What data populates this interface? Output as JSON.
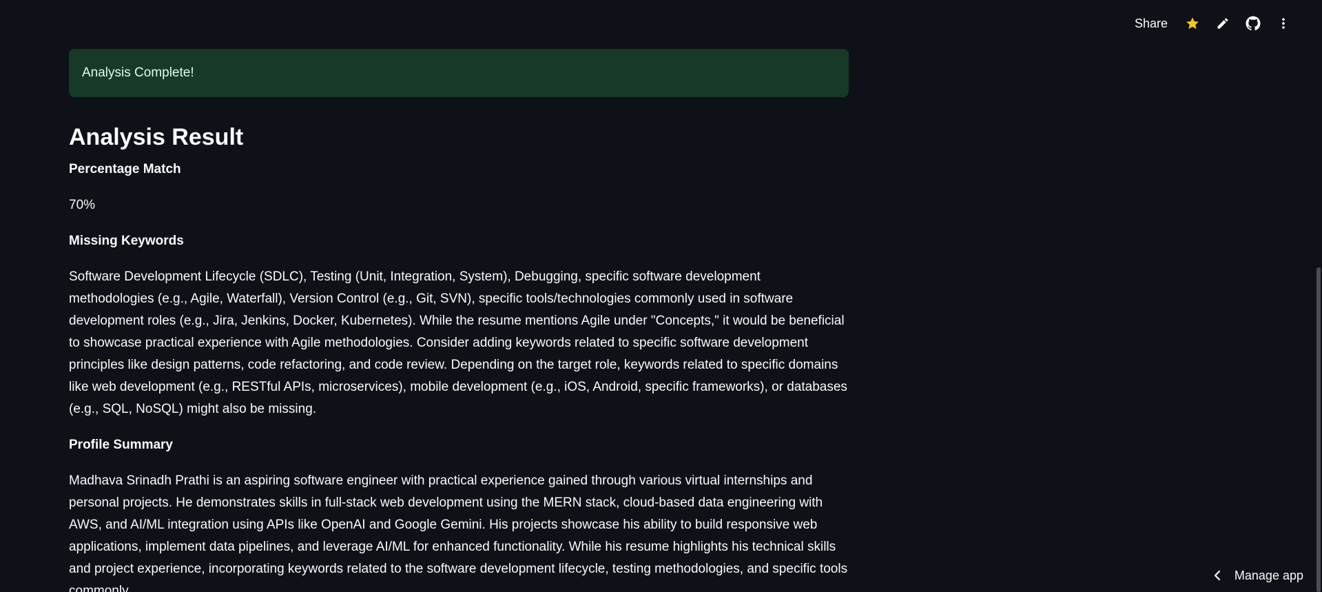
{
  "toolbar": {
    "share_label": "Share",
    "icons": [
      "star-icon",
      "pencil-icon",
      "github-icon",
      "more-vertical-icon"
    ],
    "star_color": "#f8c61b"
  },
  "alert": {
    "text": "Analysis Complete!",
    "bg_color": "#173928"
  },
  "result": {
    "title": "Analysis Result",
    "percentage_match": {
      "heading": "Percentage Match",
      "value": "70%"
    },
    "missing_keywords": {
      "heading": "Missing Keywords",
      "text": "Software Development Lifecycle (SDLC), Testing (Unit, Integration, System), Debugging, specific software development methodologies (e.g., Agile, Waterfall), Version Control (e.g., Git, SVN), specific tools/technologies commonly used in software development roles (e.g., Jira, Jenkins, Docker, Kubernetes). While the resume mentions Agile under \"Concepts,\" it would be beneficial to showcase practical experience with Agile methodologies. Consider adding keywords related to specific software development principles like design patterns, code refactoring, and code review. Depending on the target role, keywords related to specific domains like web development (e.g., RESTful APIs, microservices), mobile development (e.g., iOS, Android, specific frameworks), or databases (e.g., SQL, NoSQL) might also be missing."
    },
    "profile_summary": {
      "heading": "Profile Summary",
      "text": "Madhava Srinadh Prathi is an aspiring software engineer with practical experience gained through various virtual internships and personal projects. He demonstrates skills in full-stack web development using the MERN stack, cloud-based data engineering with AWS, and AI/ML integration using APIs like OpenAI and Google Gemini. His projects showcase his ability to build responsive web applications, implement data pipelines, and leverage AI/ML for enhanced functionality. While his resume highlights his technical skills and project experience, incorporating keywords related to the software development lifecycle, testing methodologies, and specific tools commonly"
    }
  },
  "footer": {
    "manage_app_label": "Manage app"
  }
}
